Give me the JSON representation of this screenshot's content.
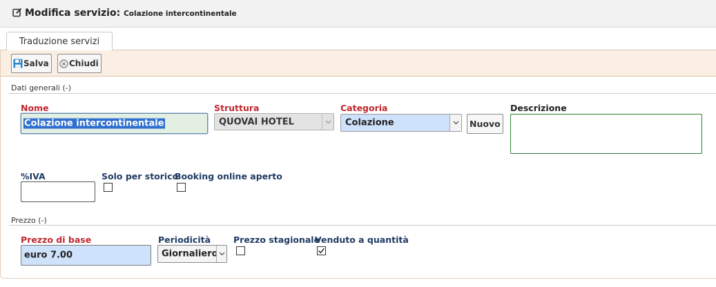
{
  "header": {
    "title": "Modifica servizio:",
    "subtitle": "Colazione intercontinentale"
  },
  "tabs": [
    {
      "label": "Traduzione servizi"
    }
  ],
  "toolbar": {
    "save_label": "Salva",
    "close_label": "Chiudi"
  },
  "sections": {
    "general": "Dati generali (-)",
    "price": "Prezzo (-)"
  },
  "form": {
    "nome": {
      "label": "Nome",
      "value": "Colazione intercontinentale"
    },
    "struttura": {
      "label": "Struttura",
      "value": "QUOVAI HOTEL"
    },
    "categoria": {
      "label": "Categoria",
      "value": "Colazione",
      "new_button": "Nuovo"
    },
    "descrizione": {
      "label": "Descrizione",
      "value": ""
    },
    "iva": {
      "label": "%IVA",
      "value": ""
    },
    "solo_storico": {
      "label": "Solo per storico",
      "checked": false
    },
    "booking_online": {
      "label": "Booking online aperto",
      "checked": false
    },
    "prezzo_base": {
      "label": "Prezzo di base",
      "value": "euro 7.00"
    },
    "periodicita": {
      "label": "Periodicità",
      "value": "Giornaliero"
    },
    "prezzo_stagionale": {
      "label": "Prezzo stagionale",
      "checked": false
    },
    "venduto_quantita": {
      "label": "Venduto a quantità",
      "checked": true
    }
  },
  "colors": {
    "required_label": "#c0262d",
    "normal_label": "#1f3b63",
    "toolbar_bg": "#fbefe4",
    "field_blue": "#cfe2fb"
  }
}
